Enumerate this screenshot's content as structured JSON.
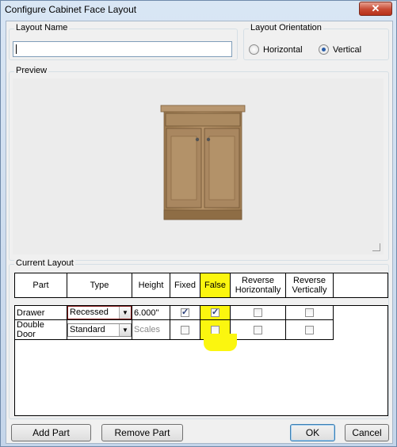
{
  "window": {
    "title": "Configure Cabinet Face Layout",
    "close_glyph": "✕"
  },
  "layout_name": {
    "label": "Layout Name",
    "value": ""
  },
  "orientation": {
    "label": "Layout Orientation",
    "options": [
      "Horizontal",
      "Vertical"
    ],
    "selected": "Vertical"
  },
  "preview": {
    "label": "Preview"
  },
  "current_layout": {
    "label": "Current Layout",
    "headers": {
      "part": "Part",
      "type": "Type",
      "height": "Height",
      "fixed": "Fixed",
      "false": "False",
      "reverse_h_1": "Reverse",
      "reverse_h_2": "Horizontally",
      "reverse_v_1": "Reverse",
      "reverse_v_2": "Vertically"
    },
    "rows": [
      {
        "part": "Drawer",
        "type": "Recessed",
        "height": "6.000\"",
        "fixed": true,
        "false": true,
        "reverse_h": false,
        "reverse_v": false
      },
      {
        "part": "Double Door",
        "type": "Standard",
        "height": "Scales",
        "fixed": false,
        "false": false,
        "reverse_h": false,
        "reverse_v": false
      }
    ]
  },
  "buttons": {
    "add_part": "Add Part",
    "remove_part": "Remove Part",
    "ok": "OK",
    "cancel": "Cancel"
  },
  "colors": {
    "highlight": "#fbf60f",
    "cabinet_wood": "#a9865c"
  }
}
